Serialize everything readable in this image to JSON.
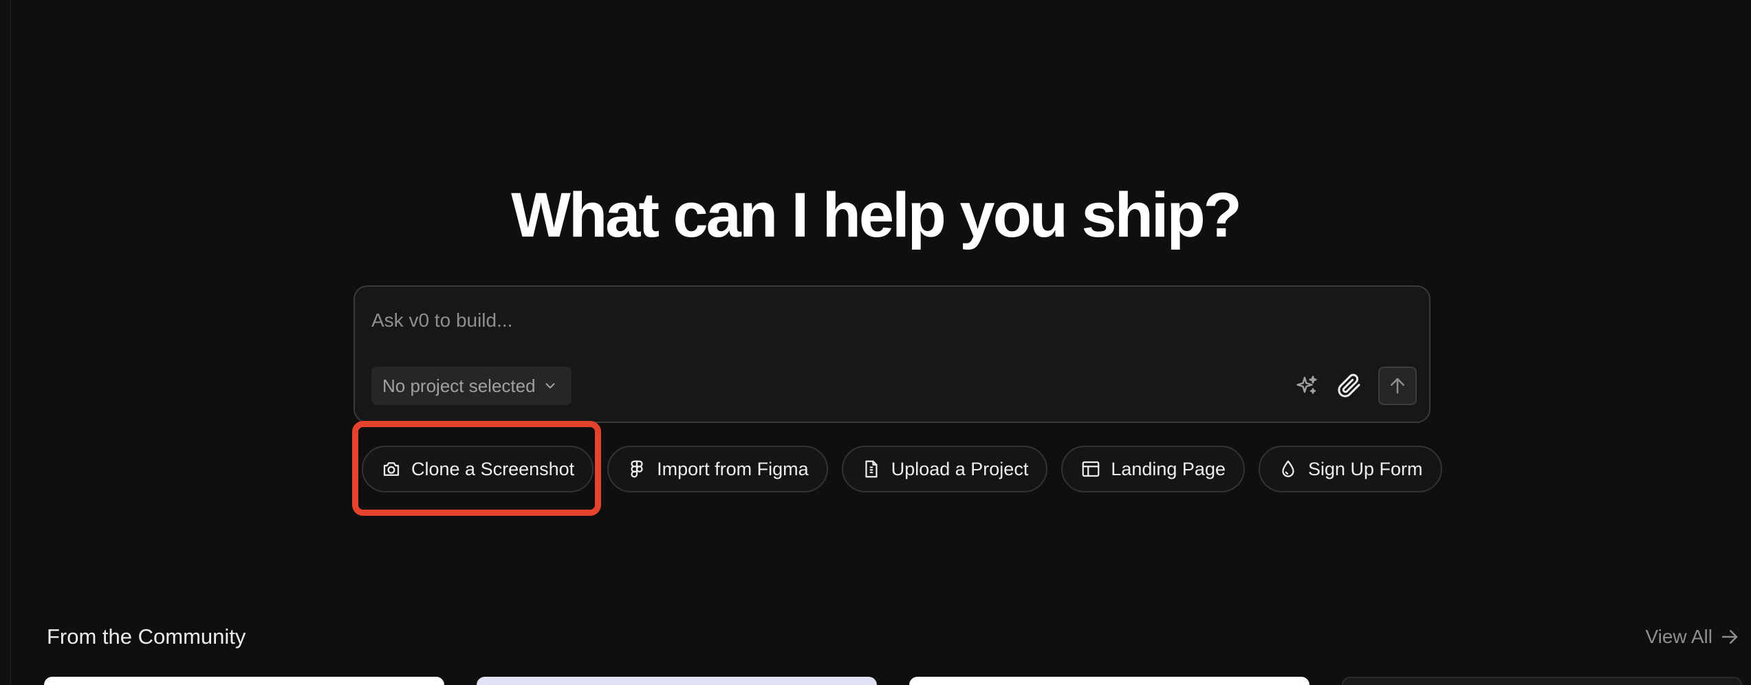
{
  "headline": "What can I help you ship?",
  "prompt": {
    "placeholder": "Ask v0 to build...",
    "project_select": "No project selected",
    "tool_icons": [
      "sparkles-icon",
      "paperclip-icon",
      "arrow-up-icon"
    ]
  },
  "chips": [
    {
      "label": "Clone a Screenshot",
      "icon": "camera-icon"
    },
    {
      "label": "Import from Figma",
      "icon": "figma-icon"
    },
    {
      "label": "Upload a Project",
      "icon": "file-upload-icon"
    },
    {
      "label": "Landing Page",
      "icon": "layout-icon"
    },
    {
      "label": "Sign Up Form",
      "icon": "droplet-icon"
    }
  ],
  "community": {
    "title": "From the Community",
    "view_all": "View All"
  },
  "colors": {
    "background": "#0f0f0f",
    "highlight": "#e4432d",
    "text_primary": "#ffffff",
    "text_muted": "#8f8f8f"
  }
}
